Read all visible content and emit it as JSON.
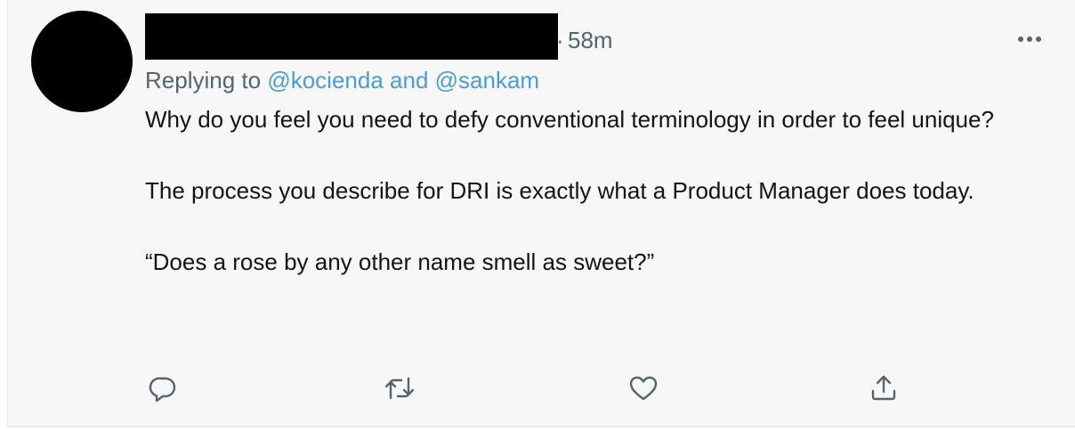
{
  "tweet": {
    "timestamp": "58m",
    "separator": "·",
    "reply_prefix": "Replying to",
    "reply_mention_1": "@kocienda",
    "reply_and": "and",
    "reply_mention_2": "@sankam",
    "paragraphs": [
      "Why do you feel you need to defy conventional terminology in order to feel unique?",
      "The process you describe for DRI is exactly what a Product Manager does today.",
      "“Does a rose by any other name smell as sweet?”"
    ]
  },
  "icons": {
    "more": "more-horizontal-icon",
    "reply": "reply-icon",
    "retweet": "retweet-icon",
    "like": "like-icon",
    "share": "share-icon"
  },
  "colors": {
    "background": "#f7f7f7",
    "text": "#0f1419",
    "secondary": "#536471",
    "link": "#4a9cd8"
  }
}
